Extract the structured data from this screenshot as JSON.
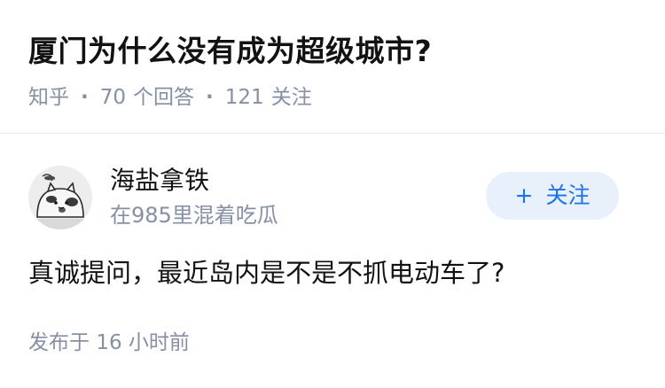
{
  "question": {
    "title": "厦门为什么没有成为超级城市?",
    "source": "知乎",
    "separator": "·",
    "answer_count": "70",
    "answer_count_label": "个回答",
    "follower_count": "121",
    "follower_count_label": "关注"
  },
  "author": {
    "name": "海盐拿铁",
    "bio": "在985里混着吃瓜",
    "avatar_icon": "cat-avatar-icon"
  },
  "follow_button": {
    "plus_icon": "+",
    "label": "关注"
  },
  "answer": {
    "content": "真诚提问，最近岛内是不是不抓电动车了?",
    "published_label": "发布于",
    "published_time": "16 小时前"
  },
  "colors": {
    "title_text": "#121212",
    "meta_text": "#8590a6",
    "accent": "#1772f6",
    "follow_bg": "#e8f1fb",
    "divider": "#ebebeb"
  }
}
